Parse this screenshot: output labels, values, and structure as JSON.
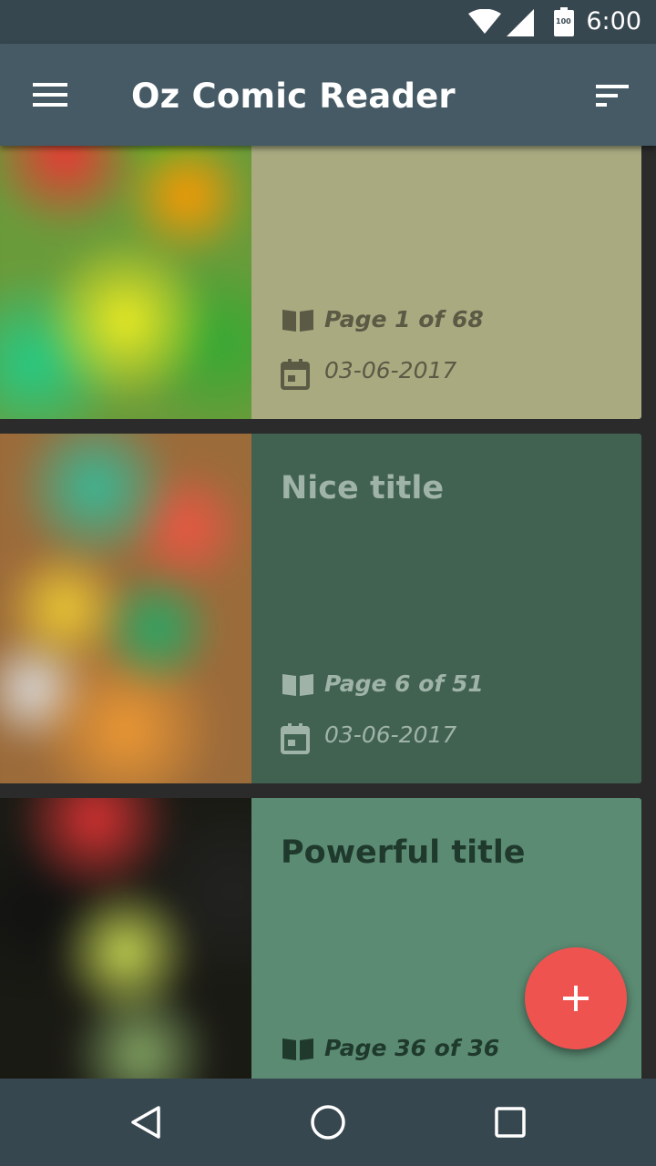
{
  "status_bar": {
    "time": "6:00",
    "battery_level": "100",
    "icons": [
      "wifi-icon",
      "signal-icon",
      "battery-icon"
    ]
  },
  "app_bar": {
    "title": "Oz Comic Reader",
    "menu_icon": "hamburger-menu-icon",
    "sort_icon": "sort-icon"
  },
  "comics": [
    {
      "title": "",
      "page_label": "Page 1 of 68",
      "date": "03-06-2017",
      "color": "#a9aa80",
      "text_color": "#5a5a45"
    },
    {
      "title": "Nice title",
      "page_label": "Page 6 of 51",
      "date": "03-06-2017",
      "color": "#416251",
      "text_color": "#9fb3a8"
    },
    {
      "title": "Powerful title",
      "page_label": "Page 36 of 36",
      "date": "",
      "color": "#5b8b73",
      "text_color": "#1f3a2c"
    }
  ],
  "fab": {
    "icon": "plus-icon"
  },
  "nav_bar": {
    "icons": [
      "back-icon",
      "home-icon",
      "recents-icon"
    ]
  },
  "colors": {
    "status_bar": "#37474f",
    "app_bar": "#455a64",
    "accent": "#ef5350",
    "background": "#2b2b2b"
  }
}
